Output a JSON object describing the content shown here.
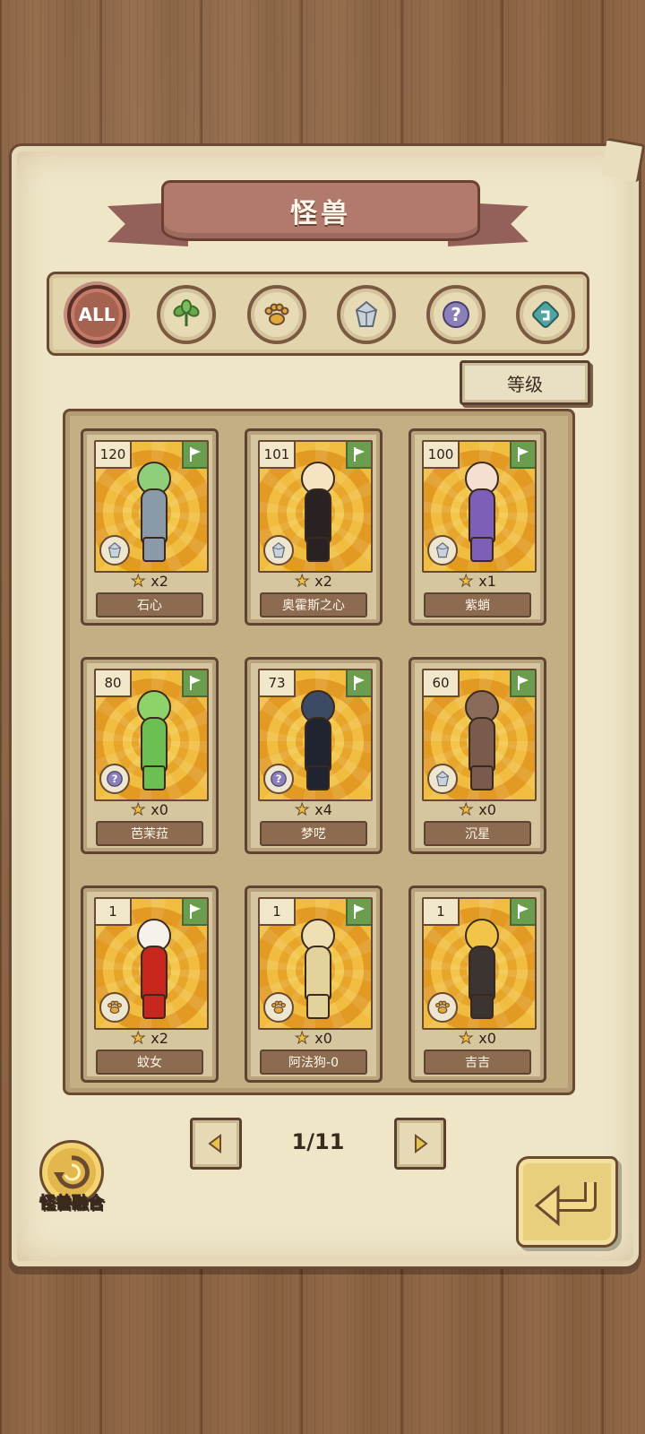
{
  "title": "怪兽",
  "filters": [
    {
      "id": "all",
      "label": "ALL",
      "icon": "all-icon",
      "active": true
    },
    {
      "id": "plant",
      "label": "",
      "icon": "leaf-icon",
      "color": "#6aa84f"
    },
    {
      "id": "beast",
      "label": "",
      "icon": "paw-icon",
      "color": "#e2a83a"
    },
    {
      "id": "mineral",
      "label": "",
      "icon": "crystal-icon",
      "color": "#9aa4ad"
    },
    {
      "id": "unknown",
      "label": "",
      "icon": "question-icon",
      "color": "#8a7fb8"
    },
    {
      "id": "mech",
      "label": "",
      "icon": "gear-icon",
      "color": "#4fa3a0"
    }
  ],
  "sort": {
    "label": "等级"
  },
  "cards": [
    {
      "level": "120",
      "count": "x2",
      "name": "石心",
      "type_icon": "crystal-icon",
      "skin": "#8fce7a",
      "outfit": "#8a9aa8"
    },
    {
      "level": "101",
      "count": "x2",
      "name": "奥霍斯之心",
      "type_icon": "crystal-icon",
      "skin": "#f5e3c2",
      "outfit": "#2a2222"
    },
    {
      "level": "100",
      "count": "x1",
      "name": "紫蛸",
      "type_icon": "crystal-icon",
      "skin": "#f4dfd0",
      "outfit": "#7e5fb8"
    },
    {
      "level": "80",
      "count": "x0",
      "name": "芭茉菈",
      "type_icon": "question-icon",
      "skin": "#8ed36a",
      "outfit": "#6cbf52"
    },
    {
      "level": "73",
      "count": "x4",
      "name": "梦呓",
      "type_icon": "question-icon",
      "skin": "#3c4a64",
      "outfit": "#1f2430"
    },
    {
      "level": "60",
      "count": "x0",
      "name": "沉星",
      "type_icon": "crystal-icon",
      "skin": "#8a6a58",
      "outfit": "#7a5a4a"
    },
    {
      "level": "1",
      "count": "x2",
      "name": "蚊女",
      "type_icon": "paw-icon",
      "skin": "#f6f1ea",
      "outfit": "#c7261e"
    },
    {
      "level": "1",
      "count": "x0",
      "name": "阿法狗-0",
      "type_icon": "paw-icon",
      "skin": "#efe0b4",
      "outfit": "#e4d29c"
    },
    {
      "level": "1",
      "count": "x0",
      "name": "吉吉",
      "type_icon": "paw-icon",
      "skin": "#f2c54a",
      "outfit": "#3b3430"
    }
  ],
  "pagination": {
    "label": "1/11"
  },
  "fusion": {
    "label": "怪兽融合"
  }
}
